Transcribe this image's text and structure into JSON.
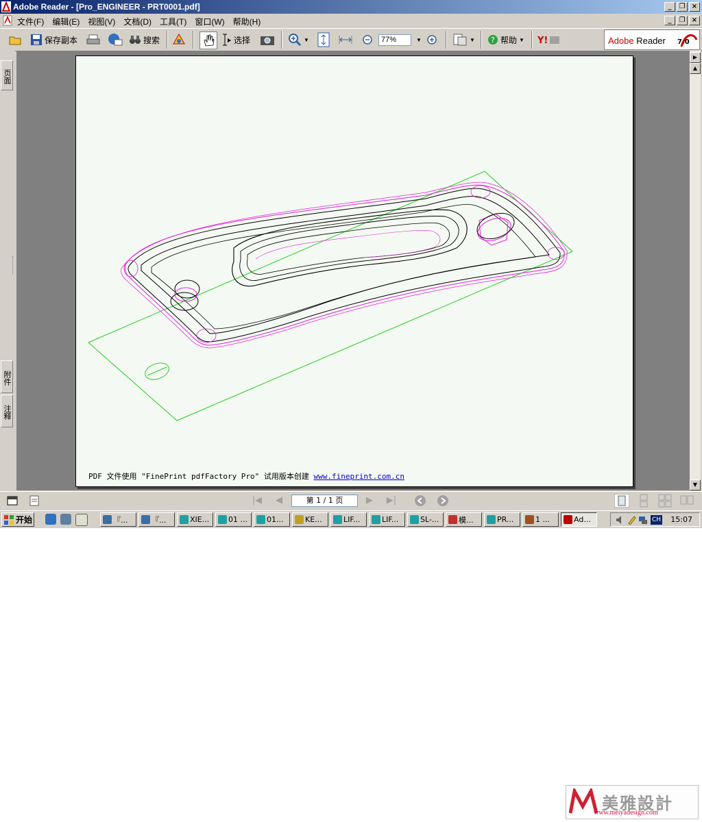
{
  "window": {
    "title": "Adobe Reader - [Pro_ENGINEER - PRT0001.pdf]",
    "caption_buttons": [
      "_",
      "❐",
      "×"
    ]
  },
  "menu": {
    "items": [
      "文件(F)",
      "编辑(E)",
      "视图(V)",
      "文档(D)",
      "工具(T)",
      "窗口(W)",
      "帮助(H)"
    ]
  },
  "toolbar": {
    "save_copy": "保存副本",
    "search": "搜索",
    "select": "选择",
    "zoom_value": "77%",
    "help": "帮助",
    "brand_adobe": "Adobe",
    "brand_reader": "Reader",
    "brand_version": "7.0"
  },
  "nav_tabs": {
    "pages": "页面",
    "attachments": "附件",
    "comments": "注释"
  },
  "document": {
    "footer_text": "PDF 文件使用 \"FinePrint pdfFactory Pro\" 试用版本创建",
    "footer_link": "www.fineprint.com.cn"
  },
  "statusbar": {
    "page_indicator": "第 1 / 1 页"
  },
  "taskbar": {
    "start_label": "开始",
    "tasks": [
      "『...",
      "『...",
      "XIE...",
      "01 ...",
      "01...",
      "KE...",
      "LIF...",
      "LIF...",
      "SL-...",
      "模...",
      "PR...",
      "1 ...",
      "Ad..."
    ],
    "task_colors": [
      "#3a6ea5",
      "#3a6ea5",
      "#20a0a0",
      "#20a0a0",
      "#20a0a0",
      "#c0a020",
      "#20a0a0",
      "#20a0a0",
      "#20a0a0",
      "#c03030",
      "#20a0a0",
      "#a05020",
      "#c00000"
    ],
    "active_task": "Ad...",
    "clock": "15:07",
    "ime": "CH"
  },
  "watermark": {
    "text": "美雅設計",
    "url": "www.meiyadesign.com"
  },
  "colors": {
    "outline_magenta": "#e020e0",
    "outline_green": "#20d020",
    "outline_black": "#000000"
  }
}
